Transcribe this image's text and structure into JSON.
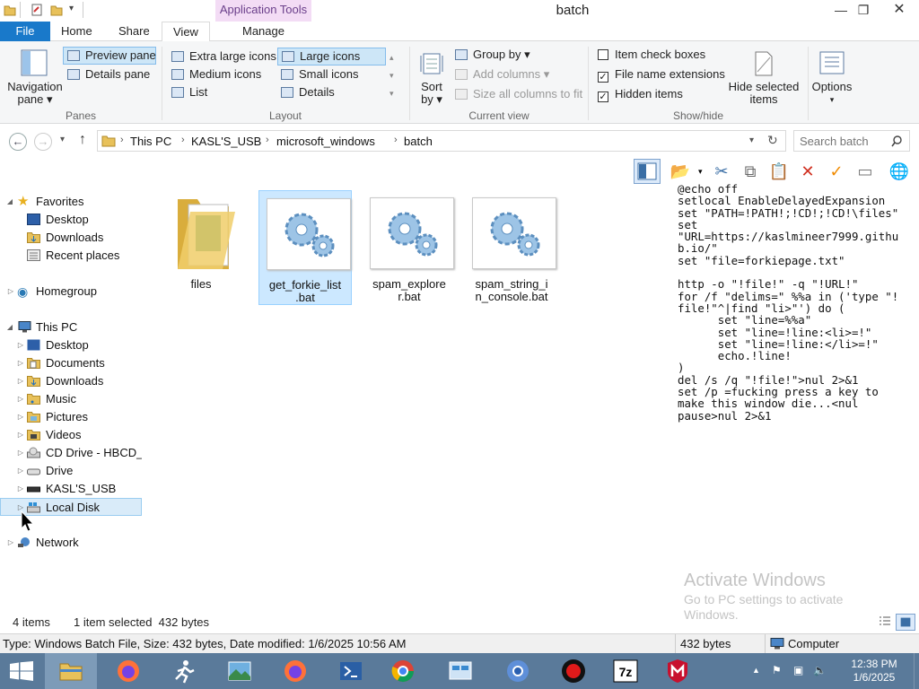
{
  "window": {
    "title": "batch",
    "context_tab": "Application Tools",
    "minimize": "—",
    "maximize": "❐",
    "close": "✕"
  },
  "tabs": {
    "file": "File",
    "home": "Home",
    "share": "Share",
    "view": "View",
    "manage": "Manage"
  },
  "ribbon": {
    "panes": {
      "navigation_pane": [
        "Navigation",
        "pane ▾"
      ],
      "preview_pane": "Preview pane",
      "details_pane": "Details pane",
      "label": "Panes"
    },
    "layout": {
      "extra_large_icons": "Extra large icons",
      "large_icons": "Large icons",
      "medium_icons": "Medium icons",
      "small_icons": "Small icons",
      "list": "List",
      "details": "Details",
      "label": "Layout"
    },
    "current_view": {
      "sort_by": [
        "Sort",
        "by ▾"
      ],
      "group_by": "Group by ▾",
      "add_columns": "Add columns ▾",
      "size_all_columns": "Size all columns to fit",
      "label": "Current view"
    },
    "show_hide": {
      "item_check_boxes": "Item check boxes",
      "item_check_boxes_checked": false,
      "file_name_extensions": "File name extensions",
      "file_name_extensions_checked": true,
      "hidden_items": "Hidden items",
      "hidden_items_checked": true,
      "hide_selected_items": [
        "Hide selected",
        "items"
      ],
      "label": "Show/hide"
    },
    "options": "Options"
  },
  "address": {
    "crumbs": [
      "This PC",
      "KASL'S_USB",
      "microsoft_windows",
      "batch"
    ],
    "search_placeholder": "Search batch"
  },
  "nav": {
    "favorites": "Favorites",
    "fav_items": [
      "Desktop",
      "Downloads",
      "Recent places"
    ],
    "homegroup": "Homegroup",
    "this_pc": "This PC",
    "pc_items": [
      "Desktop",
      "Documents",
      "Downloads",
      "Music",
      "Pictures",
      "Videos",
      "CD Drive - HBCD_",
      "Drive",
      "KASL'S_USB",
      "Local Disk"
    ],
    "network": "Network"
  },
  "files": [
    {
      "name": "files",
      "type": "folder"
    },
    {
      "name": "get_forkie_list .bat",
      "type": "bat",
      "selected": true
    },
    {
      "name": "spam_explore r.bat",
      "type": "bat"
    },
    {
      "name": "spam_string_i n_console.bat",
      "type": "bat"
    }
  ],
  "preview_text": "@echo off\nsetlocal EnableDelayedExpansion\nset \"PATH=!PATH!;!CD!;!CD!\\files\"\nset\n\"URL=https://kaslmineer7999.githu\nb.io/\"\nset \"file=forkiepage.txt\"\n\nhttp -o \"!file!\" -q \"!URL!\"\nfor /f \"delims=\" %%a in ('type \"!\nfile!\"^|find \"li>\"') do (\n      set \"line=%%a\"\n      set \"line=!line:<li>=!\"\n      set \"line=!line:</li>=!\"\n      echo.!line!\n)\ndel /s /q \"!file!\">nul 2>&1\nset /p =fucking press a key to\nmake this window die...<nul\npause>nul 2>&1",
  "watermark": {
    "title": "Activate Windows",
    "subtitle": "Go to PC settings to activate\nWindows."
  },
  "status": {
    "items": "4 items",
    "selected": "1 item selected  432 bytes"
  },
  "info": {
    "details": "Type: Windows Batch File, Size: 432 bytes, Date modified: 1/6/2025 10:56 AM",
    "size": "432 bytes",
    "location": "Computer"
  },
  "taskbar": {
    "time": "12:38 PM",
    "date": "1/6/2025"
  },
  "colors": {
    "accent": "#1979ca",
    "taskbar": "#5a7a9a",
    "selection": "#cce8ff"
  }
}
